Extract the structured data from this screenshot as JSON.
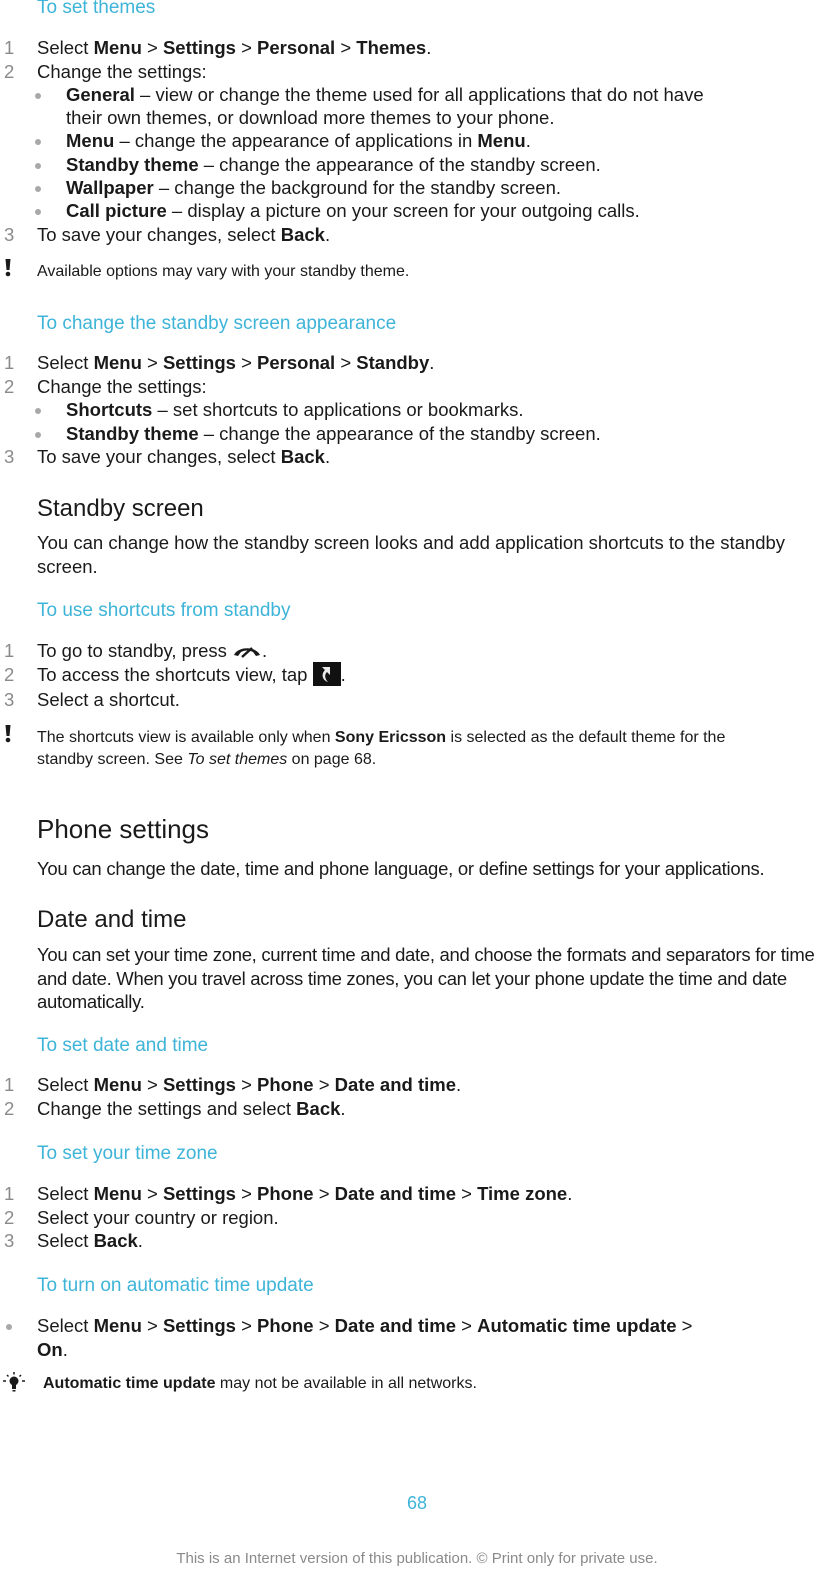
{
  "sections": {
    "set_themes": {
      "title": "To set themes",
      "step1": {
        "num": "1",
        "pre": "Select ",
        "p1": "Menu",
        "sep": " > ",
        "p2": "Settings",
        "p3": "Personal",
        "p4": "Themes",
        "end": "."
      },
      "step2": {
        "num": "2",
        "text": "Change the settings:"
      },
      "bullets": [
        {
          "term": "General",
          "desc": " – view or change the theme used for all applications that do not have",
          "desc2": "their own themes, or download more themes to your phone."
        },
        {
          "term": "Menu",
          "desc": " – change the appearance of applications in ",
          "term2": "Menu",
          "end": "."
        },
        {
          "term": "Standby theme",
          "desc": " – change the appearance of the standby screen."
        },
        {
          "term": "Wallpaper",
          "desc": " – change the background for the standby screen."
        },
        {
          "term": "Call picture",
          "desc": " – display a picture on your screen for your outgoing calls."
        }
      ],
      "step3": {
        "num": "3",
        "pre": "To save your changes, select ",
        "term": "Back",
        "end": "."
      },
      "note": "Available options may vary with your standby theme."
    },
    "standby_appearance": {
      "title": "To change the standby screen appearance",
      "step1": {
        "num": "1",
        "pre": "Select ",
        "p1": "Menu",
        "sep": " > ",
        "p2": "Settings",
        "p3": "Personal",
        "p4": "Standby",
        "end": "."
      },
      "step2": {
        "num": "2",
        "text": "Change the settings:"
      },
      "bullets": [
        {
          "term": "Shortcuts",
          "desc": " – set shortcuts to applications or bookmarks."
        },
        {
          "term": "Standby theme",
          "desc": " – change the appearance of the standby screen."
        }
      ],
      "step3": {
        "num": "3",
        "pre": "To save your changes, select ",
        "term": "Back",
        "end": "."
      }
    },
    "standby_screen": {
      "title": "Standby screen",
      "body": "You can change how the standby screen looks and add application shortcuts to the standby screen."
    },
    "shortcuts": {
      "title": "To use shortcuts from standby",
      "step1": {
        "num": "1",
        "text": "To go to standby, press ",
        "end": "."
      },
      "step2": {
        "num": "2",
        "text": "To access the shortcuts view, tap ",
        "end": "."
      },
      "step3": {
        "num": "3",
        "text": "Select a shortcut."
      },
      "note": {
        "pre": "The shortcuts view is available only when ",
        "term": "Sony Ericsson",
        "post": " is selected as the default theme for the",
        "line2_pre": "standby screen. See ",
        "link": "To set themes",
        "line2_post": " on page 68."
      }
    },
    "phone_settings": {
      "title": "Phone settings",
      "body": "You can change the date, time and phone language, or define settings for your applications."
    },
    "date_time": {
      "title": "Date and time",
      "body": "You can set your time zone, current time and date, and choose the formats and separators for time and date. When you travel across time zones, you can let your phone update the time and date automatically."
    },
    "set_date_time": {
      "title": "To set date and time",
      "step1": {
        "num": "1",
        "pre": "Select ",
        "p1": "Menu",
        "sep": " > ",
        "p2": "Settings",
        "p3": "Phone",
        "p4": "Date and time",
        "end": "."
      },
      "step2": {
        "num": "2",
        "pre": "Change the settings and select ",
        "term": "Back",
        "end": "."
      }
    },
    "time_zone": {
      "title": "To set your time zone",
      "step1": {
        "num": "1",
        "pre": "Select ",
        "p1": "Menu",
        "sep": " > ",
        "p2": "Settings",
        "p3": "Phone",
        "p4": "Date and time",
        "p5": "Time zone",
        "end": "."
      },
      "step2": {
        "num": "2",
        "text": "Select your country or region."
      },
      "step3": {
        "num": "3",
        "pre": "Select ",
        "term": "Back",
        "end": "."
      }
    },
    "auto_time": {
      "title": "To turn on automatic time update",
      "step": {
        "pre": "Select ",
        "p1": "Menu",
        "sep": " > ",
        "p2": "Settings",
        "p3": "Phone",
        "p4": "Date and time",
        "p5": "Automatic time update",
        "p6": "On",
        "end": "."
      },
      "tip": {
        "term": "Automatic time update",
        "post": " may not be available in all networks."
      }
    }
  },
  "footer": {
    "page_number": "68",
    "notice": "This is an Internet version of this publication. © Print only for private use."
  },
  "colors": {
    "heading_blue": "#3eb4d8",
    "text": "#1a1a1a",
    "numbers": "#8a8a8a"
  }
}
